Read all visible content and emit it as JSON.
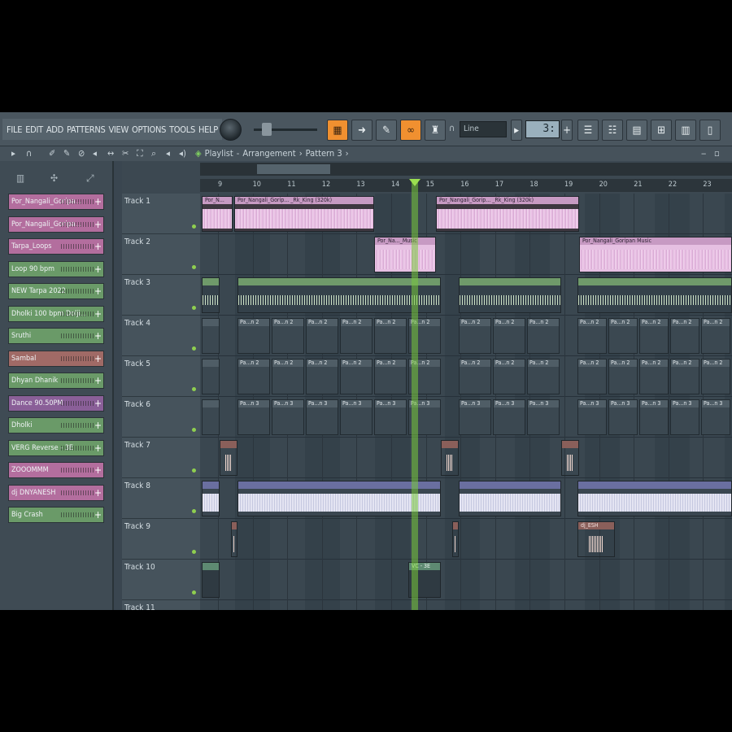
{
  "menu": [
    "FILE",
    "EDIT",
    "ADD",
    "PATTERNS",
    "VIEW",
    "OPTIONS",
    "TOOLS",
    "HELP"
  ],
  "transport": {
    "snap_value": "Line",
    "tempo": "3:"
  },
  "breadcrumb": {
    "title": "Playlist",
    "sep1": "-",
    "arrangement": "Arrangement",
    "sep2": "›",
    "pattern": "Pattern 3",
    "sep3": "›"
  },
  "channels": [
    {
      "label": "Por_Nangali_Goripa...",
      "color": "#b36e9e"
    },
    {
      "label": "Por_Nangali_Goripa...",
      "color": "#b36e9e"
    },
    {
      "label": "Tarpa_Loops",
      "color": "#b36e9e"
    },
    {
      "label": "Loop 90 bpm",
      "color": "#6a9a68"
    },
    {
      "label": "NEW Tarpa 2022",
      "color": "#6a9a68"
    },
    {
      "label": "Dholki 100 bpm Dolji...",
      "color": "#6a9a68"
    },
    {
      "label": "Sruthi",
      "color": "#6a9a68"
    },
    {
      "label": "Sambal",
      "color": "#a06a66"
    },
    {
      "label": "Dhyan Dhanik",
      "color": "#6a9a68"
    },
    {
      "label": "Dance 90.50PM",
      "color": "#8a5f98"
    },
    {
      "label": "Dholki",
      "color": "#6a9a68"
    },
    {
      "label": "VERG Reverse - 3E",
      "color": "#6a9a68"
    },
    {
      "label": "ZOOOMMM",
      "color": "#b36e9e"
    },
    {
      "label": "dj DNYANESH",
      "color": "#b36e9e"
    },
    {
      "label": "Big Crash",
      "color": "#6a9a68"
    }
  ],
  "tracks": [
    "Track 1",
    "Track 2",
    "Track 3",
    "Track 4",
    "Track 5",
    "Track 6",
    "Track 7",
    "Track 8",
    "Track 9",
    "Track 10",
    "Track 11"
  ],
  "bars": [
    "9",
    "10",
    "11",
    "12",
    "13",
    "14",
    "15",
    "16",
    "17",
    "18",
    "19",
    "20",
    "21",
    "22",
    "23"
  ],
  "clips": {
    "t1a": "Por_N...",
    "t1b": "Por_Nangali_Gorip... _Rk_King (320k)",
    "t1c": "Por_Nangali_Gorip... _Rk_King (320k)",
    "t2a": "Por_Na..._Music",
    "t2b": "Por_Nangali_Goripan Music",
    "pat2": "Pa...n 2",
    "pat3": "Pa...n 3",
    "t9": "dj_ESH",
    "t10": "VC - 3E"
  }
}
